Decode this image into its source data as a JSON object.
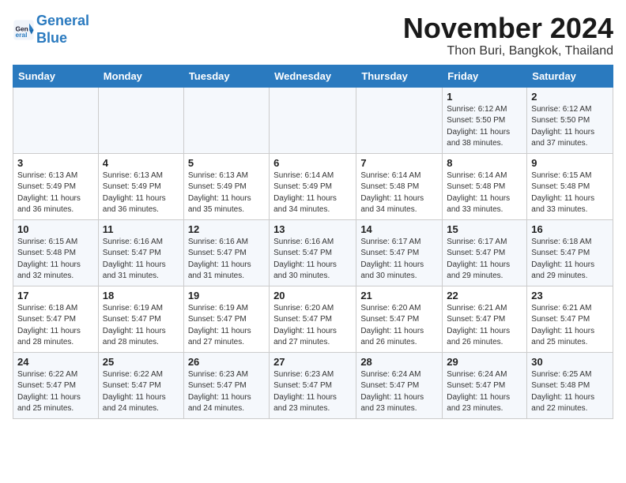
{
  "logo": {
    "line1": "General",
    "line2": "Blue"
  },
  "title": "November 2024",
  "location": "Thon Buri, Bangkok, Thailand",
  "headers": [
    "Sunday",
    "Monday",
    "Tuesday",
    "Wednesday",
    "Thursday",
    "Friday",
    "Saturday"
  ],
  "weeks": [
    [
      {
        "day": "",
        "info": ""
      },
      {
        "day": "",
        "info": ""
      },
      {
        "day": "",
        "info": ""
      },
      {
        "day": "",
        "info": ""
      },
      {
        "day": "",
        "info": ""
      },
      {
        "day": "1",
        "info": "Sunrise: 6:12 AM\nSunset: 5:50 PM\nDaylight: 11 hours\nand 38 minutes."
      },
      {
        "day": "2",
        "info": "Sunrise: 6:12 AM\nSunset: 5:50 PM\nDaylight: 11 hours\nand 37 minutes."
      }
    ],
    [
      {
        "day": "3",
        "info": "Sunrise: 6:13 AM\nSunset: 5:49 PM\nDaylight: 11 hours\nand 36 minutes."
      },
      {
        "day": "4",
        "info": "Sunrise: 6:13 AM\nSunset: 5:49 PM\nDaylight: 11 hours\nand 36 minutes."
      },
      {
        "day": "5",
        "info": "Sunrise: 6:13 AM\nSunset: 5:49 PM\nDaylight: 11 hours\nand 35 minutes."
      },
      {
        "day": "6",
        "info": "Sunrise: 6:14 AM\nSunset: 5:49 PM\nDaylight: 11 hours\nand 34 minutes."
      },
      {
        "day": "7",
        "info": "Sunrise: 6:14 AM\nSunset: 5:48 PM\nDaylight: 11 hours\nand 34 minutes."
      },
      {
        "day": "8",
        "info": "Sunrise: 6:14 AM\nSunset: 5:48 PM\nDaylight: 11 hours\nand 33 minutes."
      },
      {
        "day": "9",
        "info": "Sunrise: 6:15 AM\nSunset: 5:48 PM\nDaylight: 11 hours\nand 33 minutes."
      }
    ],
    [
      {
        "day": "10",
        "info": "Sunrise: 6:15 AM\nSunset: 5:48 PM\nDaylight: 11 hours\nand 32 minutes."
      },
      {
        "day": "11",
        "info": "Sunrise: 6:16 AM\nSunset: 5:47 PM\nDaylight: 11 hours\nand 31 minutes."
      },
      {
        "day": "12",
        "info": "Sunrise: 6:16 AM\nSunset: 5:47 PM\nDaylight: 11 hours\nand 31 minutes."
      },
      {
        "day": "13",
        "info": "Sunrise: 6:16 AM\nSunset: 5:47 PM\nDaylight: 11 hours\nand 30 minutes."
      },
      {
        "day": "14",
        "info": "Sunrise: 6:17 AM\nSunset: 5:47 PM\nDaylight: 11 hours\nand 30 minutes."
      },
      {
        "day": "15",
        "info": "Sunrise: 6:17 AM\nSunset: 5:47 PM\nDaylight: 11 hours\nand 29 minutes."
      },
      {
        "day": "16",
        "info": "Sunrise: 6:18 AM\nSunset: 5:47 PM\nDaylight: 11 hours\nand 29 minutes."
      }
    ],
    [
      {
        "day": "17",
        "info": "Sunrise: 6:18 AM\nSunset: 5:47 PM\nDaylight: 11 hours\nand 28 minutes."
      },
      {
        "day": "18",
        "info": "Sunrise: 6:19 AM\nSunset: 5:47 PM\nDaylight: 11 hours\nand 28 minutes."
      },
      {
        "day": "19",
        "info": "Sunrise: 6:19 AM\nSunset: 5:47 PM\nDaylight: 11 hours\nand 27 minutes."
      },
      {
        "day": "20",
        "info": "Sunrise: 6:20 AM\nSunset: 5:47 PM\nDaylight: 11 hours\nand 27 minutes."
      },
      {
        "day": "21",
        "info": "Sunrise: 6:20 AM\nSunset: 5:47 PM\nDaylight: 11 hours\nand 26 minutes."
      },
      {
        "day": "22",
        "info": "Sunrise: 6:21 AM\nSunset: 5:47 PM\nDaylight: 11 hours\nand 26 minutes."
      },
      {
        "day": "23",
        "info": "Sunrise: 6:21 AM\nSunset: 5:47 PM\nDaylight: 11 hours\nand 25 minutes."
      }
    ],
    [
      {
        "day": "24",
        "info": "Sunrise: 6:22 AM\nSunset: 5:47 PM\nDaylight: 11 hours\nand 25 minutes."
      },
      {
        "day": "25",
        "info": "Sunrise: 6:22 AM\nSunset: 5:47 PM\nDaylight: 11 hours\nand 24 minutes."
      },
      {
        "day": "26",
        "info": "Sunrise: 6:23 AM\nSunset: 5:47 PM\nDaylight: 11 hours\nand 24 minutes."
      },
      {
        "day": "27",
        "info": "Sunrise: 6:23 AM\nSunset: 5:47 PM\nDaylight: 11 hours\nand 23 minutes."
      },
      {
        "day": "28",
        "info": "Sunrise: 6:24 AM\nSunset: 5:47 PM\nDaylight: 11 hours\nand 23 minutes."
      },
      {
        "day": "29",
        "info": "Sunrise: 6:24 AM\nSunset: 5:47 PM\nDaylight: 11 hours\nand 23 minutes."
      },
      {
        "day": "30",
        "info": "Sunrise: 6:25 AM\nSunset: 5:48 PM\nDaylight: 11 hours\nand 22 minutes."
      }
    ]
  ]
}
